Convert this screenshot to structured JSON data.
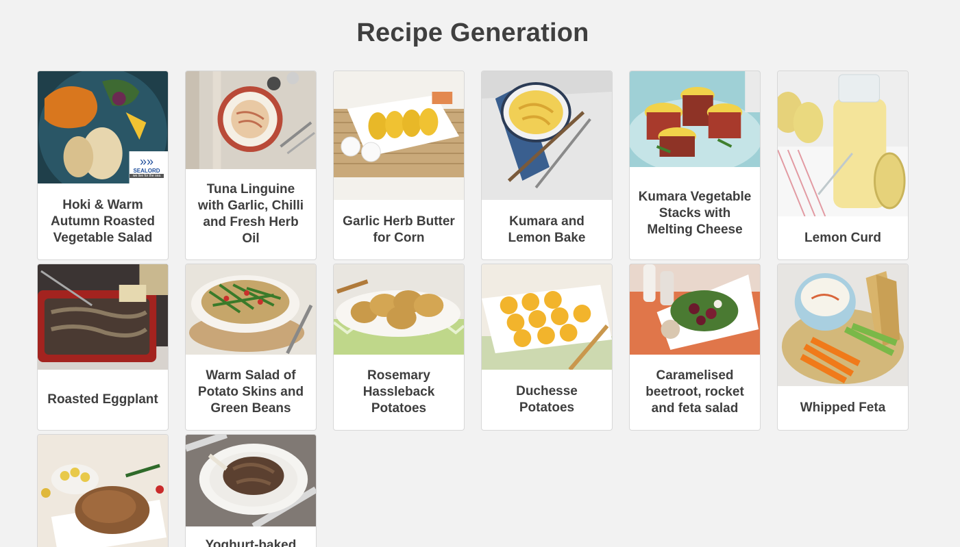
{
  "page": {
    "title": "Recipe Generation"
  },
  "recipes": [
    {
      "title": "Hoki & Warm Autumn Roasted Vegetable Salad",
      "badge": "SEALORD",
      "badge_sub": "we live for the sea"
    },
    {
      "title": "Tuna Linguine with Garlic, Chilli and Fresh Herb Oil"
    },
    {
      "title": "Garlic Herb Butter for Corn"
    },
    {
      "title": "Kumara and Lemon Bake"
    },
    {
      "title": "Kumara Vegetable Stacks with Melting Cheese"
    },
    {
      "title": "Lemon Curd"
    },
    {
      "title": "Roasted Eggplant"
    },
    {
      "title": "Warm Salad of Potato Skins and Green Beans"
    },
    {
      "title": "Rosemary Hassleback Potatoes"
    },
    {
      "title": "Duchesse Potatoes"
    },
    {
      "title": "Caramelised beetroot, rocket and feta salad"
    },
    {
      "title": "Whipped Feta"
    },
    {
      "title": ""
    },
    {
      "title": "Yoghurt-baked"
    }
  ],
  "colors": {
    "background": "#f2f2f2",
    "card": "#ffffff",
    "border": "#d7d7d7",
    "text": "#3e3e3e"
  }
}
